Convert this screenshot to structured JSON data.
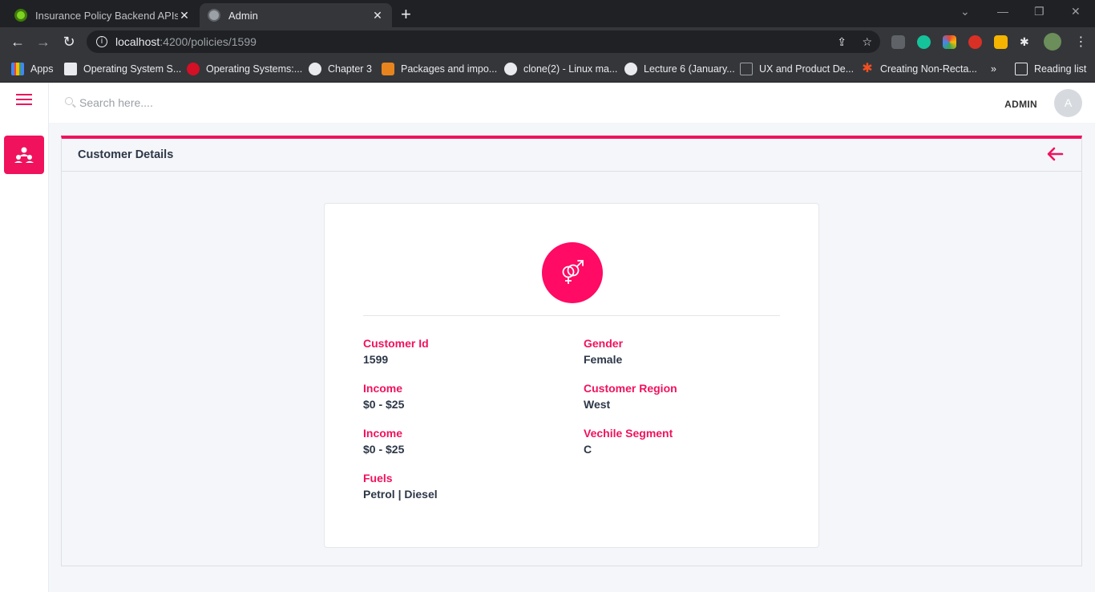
{
  "browser": {
    "tabs": [
      {
        "title": "Insurance Policy Backend APIs",
        "active": false
      },
      {
        "title": "Admin",
        "active": true
      }
    ],
    "url_host": "localhost",
    "url_path": ":4200/policies/1599",
    "bookmarks": [
      "Apps",
      "Operating System S...",
      "Operating Systems:...",
      "Chapter 3",
      "Packages and impo...",
      "clone(2) - Linux ma...",
      "Lecture 6 (January...",
      "UX and Product De...",
      "Creating Non-Recta..."
    ],
    "bookmarks_overflow": "»",
    "reading_list": "Reading list"
  },
  "header": {
    "search_placeholder": "Search here....",
    "user_label": "ADMIN",
    "avatar_initial": "A"
  },
  "panel": {
    "title": "Customer Details"
  },
  "details": {
    "left": [
      {
        "label": "Customer Id",
        "value": "1599"
      },
      {
        "label": "Income",
        "value": "$0 - $25"
      },
      {
        "label": "Income",
        "value": "$0 - $25"
      },
      {
        "label": "Fuels",
        "value": "Petrol | Diesel"
      }
    ],
    "right": [
      {
        "label": "Gender",
        "value": "Female"
      },
      {
        "label": "Customer Region",
        "value": "West"
      },
      {
        "label": "Vechile Segment",
        "value": "C"
      }
    ]
  },
  "colors": {
    "accent": "#f0125d",
    "gender_badge": "#ff0a64"
  },
  "icons": {
    "sidebar_active": "users-icon",
    "gender": "gender-symbol-icon",
    "back": "arrow-left-icon"
  }
}
